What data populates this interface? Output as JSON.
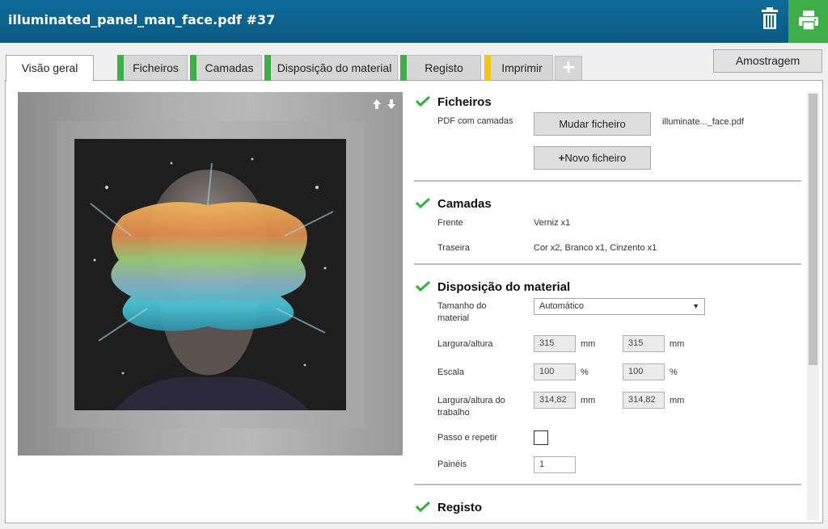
{
  "header": {
    "title": "illuminated_panel_man_face.pdf #37",
    "delete_icon": "trash-icon",
    "print_icon": "printer-icon",
    "accent_color": "#0b6590",
    "print_color": "#3fae49"
  },
  "tabs": [
    {
      "label": "Visão geral",
      "active": true,
      "status_color": ""
    },
    {
      "label": "Ficheiros",
      "active": false,
      "status_color": "#3fae49"
    },
    {
      "label": "Camadas",
      "active": false,
      "status_color": "#3fae49"
    },
    {
      "label": "Disposição do material",
      "active": false,
      "status_color": "#3fae49"
    },
    {
      "label": "Registo",
      "active": false,
      "status_color": "#3fae49"
    },
    {
      "label": "Imprimir",
      "active": false,
      "status_color": "#f0c419"
    }
  ],
  "add_tab_label": "+",
  "sampling_button": "Amostragem",
  "preview": {
    "arrows_icon": "up-down-arrows-icon"
  },
  "files": {
    "title": "Ficheiros",
    "pdf_label": "PDF com camadas",
    "change_button": "Mudar ficheiro",
    "file_name": "illuminate..._face.pdf",
    "new_button_icon": "+",
    "new_button": "Novo ficheiro"
  },
  "layers": {
    "title": "Camadas",
    "front_label": "Frente",
    "front_value": "Verniz x1",
    "back_label": "Traseira",
    "back_value": "Cor x2, Branco x1, Cinzento x1"
  },
  "layout": {
    "title": "Disposição do material",
    "material_size_label": "Tamanho do material",
    "material_size_value": "Automático",
    "wh_label": "Largura/altura",
    "width": "315",
    "height": "315",
    "mm": "mm",
    "scale_label": "Escala",
    "scale_x": "100",
    "scale_y": "100",
    "percent": "%",
    "job_wh_label": "Largura/altura do trabalho",
    "job_width": "314,82",
    "job_height": "314,82",
    "step_repeat_label": "Passo e repetir",
    "panels_label": "Painéis",
    "panels_value": "1"
  },
  "registration": {
    "title": "Registo"
  }
}
